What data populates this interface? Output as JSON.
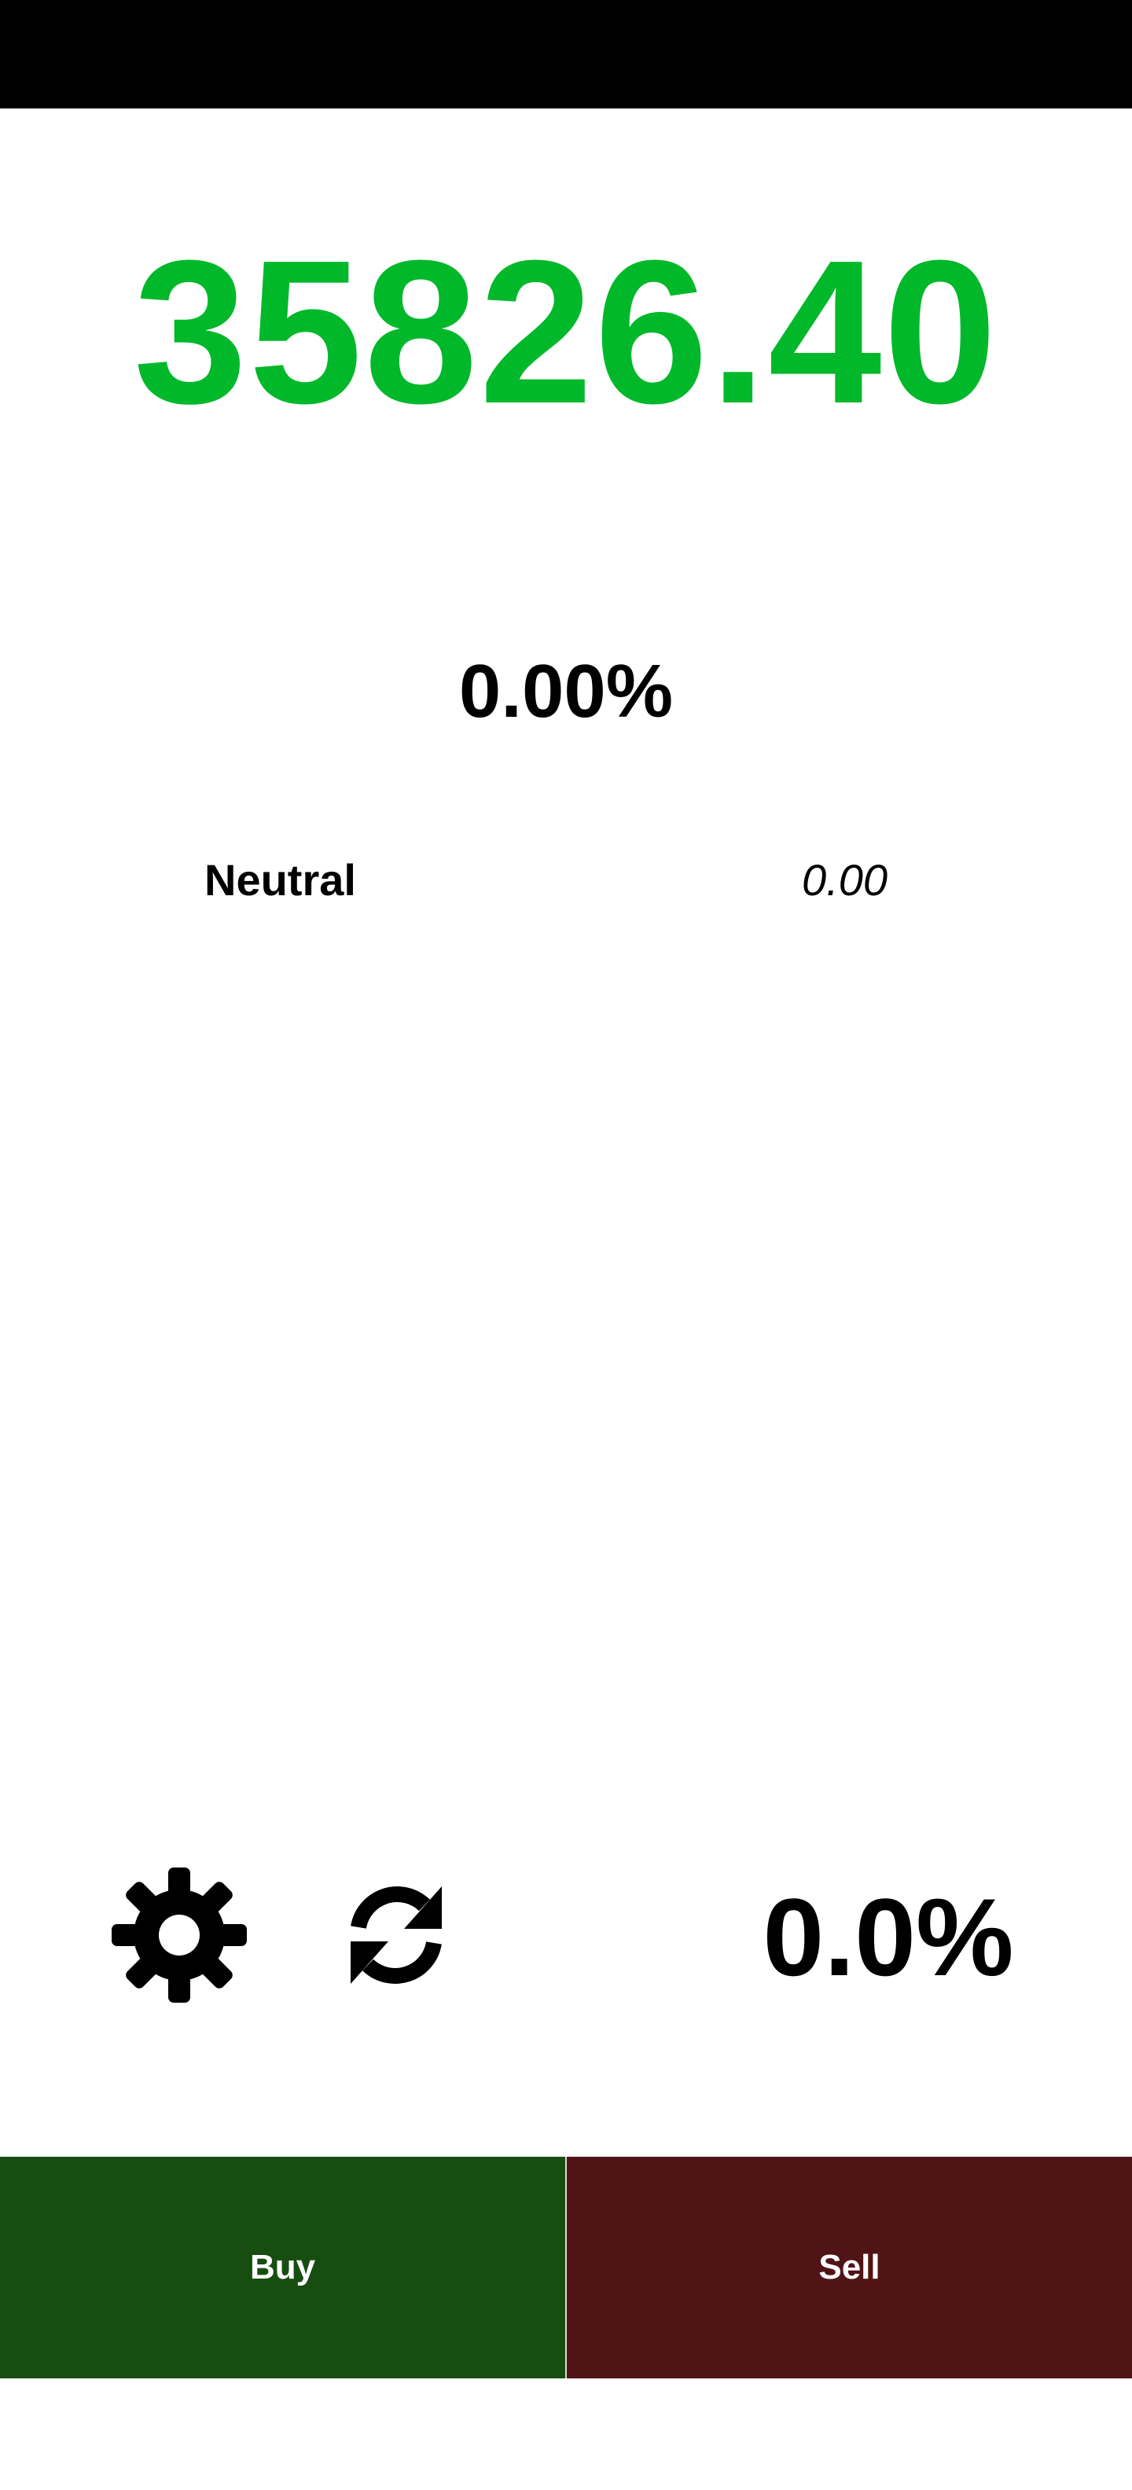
{
  "ticker": {
    "price": "35826.40",
    "price_color": "#00b82a",
    "change_percent": "0.00%"
  },
  "sentiment": {
    "label": "Neutral",
    "value": "0.00"
  },
  "controls": {
    "settings_icon": "gear-icon",
    "refresh_icon": "refresh-icon",
    "position_percent": "0.0%"
  },
  "actions": {
    "buy_label": "Buy",
    "buy_color": "#184d12",
    "sell_label": "Sell",
    "sell_color": "#511416"
  }
}
